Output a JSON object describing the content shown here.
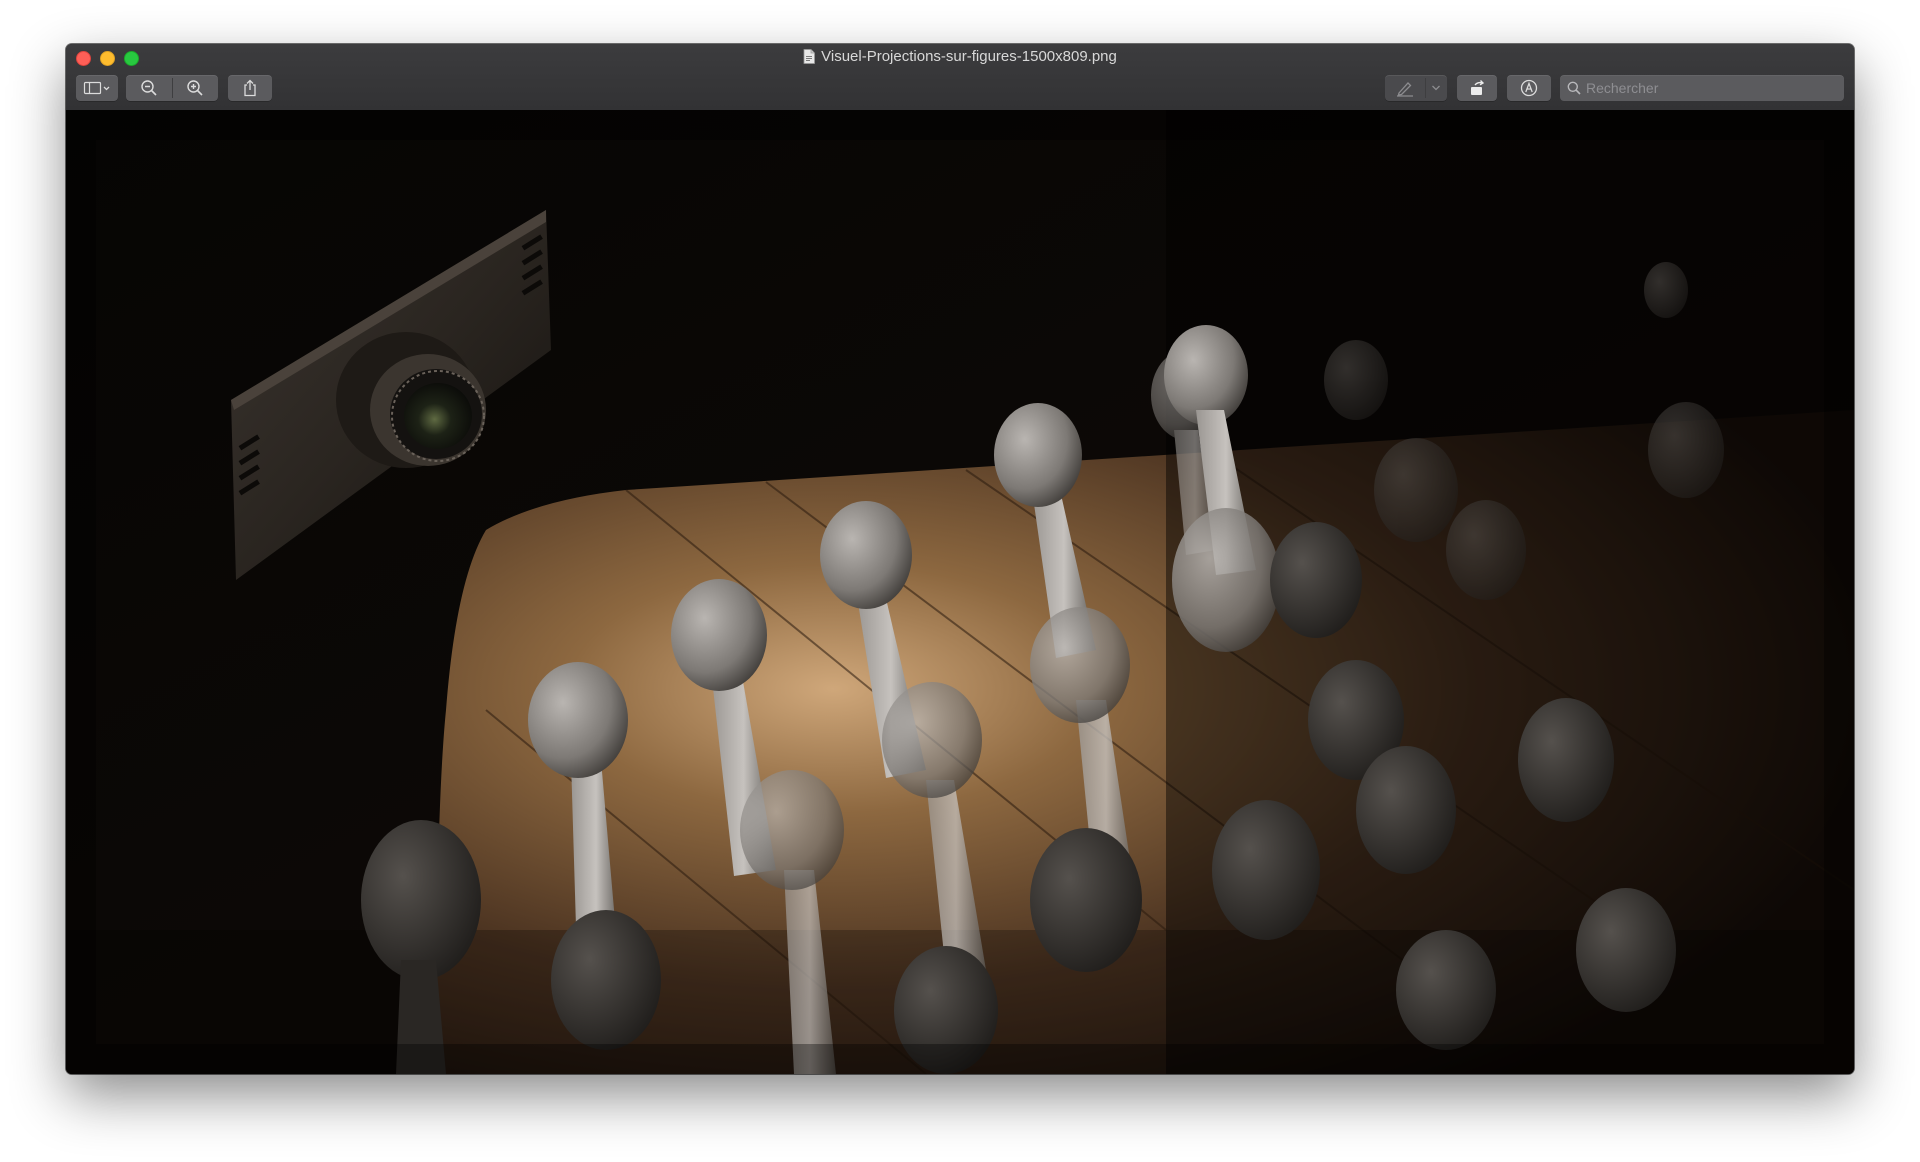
{
  "window": {
    "title": "Visuel-Projections-sur-figures-1500x809.png",
    "title_icon": "document-icon"
  },
  "traffic_lights": {
    "close_color": "#fe5f57",
    "minimize_color": "#febc2e",
    "maximize_color": "#28c840"
  },
  "toolbar": {
    "left_buttons": [
      "sidebar-toggle-icon",
      "zoom-out-icon",
      "zoom-in-icon",
      "share-icon"
    ],
    "right_buttons": [
      "markup-pen-icon",
      "rotate-icon",
      "annotate-icon"
    ]
  },
  "search": {
    "placeholder": "Rechercher",
    "value": ""
  },
  "image": {
    "name": "projector-and-figures-render",
    "description_colors": {
      "wood_light": "#b38b5c",
      "wood_dark": "#3a2616",
      "figure": "#8a8682"
    }
  }
}
